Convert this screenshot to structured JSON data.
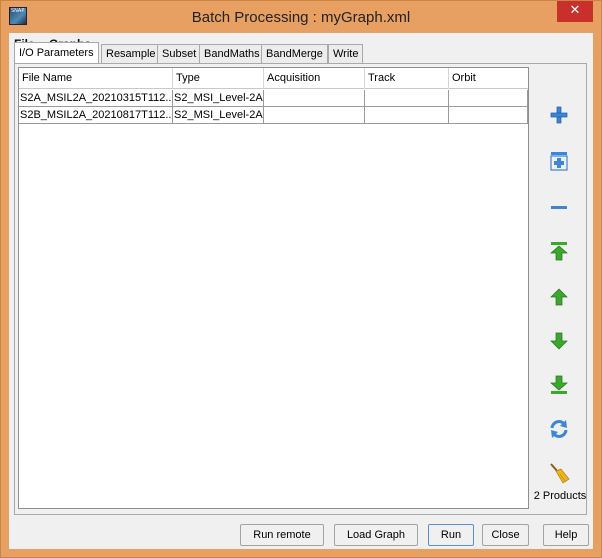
{
  "window": {
    "title": "Batch Processing : myGraph.xml",
    "close_glyph": "✕",
    "app_icon_text": "SNAP"
  },
  "menu": [
    "File",
    "Graphs"
  ],
  "tabs": [
    "I/O Parameters",
    "Resample",
    "Subset",
    "BandMaths",
    "BandMerge",
    "Write"
  ],
  "table": {
    "columns": [
      "File Name",
      "Type",
      "Acquisition",
      "Track",
      "Orbit"
    ],
    "rows": [
      [
        "S2A_MSIL2A_20210315T112...",
        "S2_MSI_Level-2A",
        "",
        "",
        ""
      ],
      [
        "S2B_MSIL2A_20210817T112...",
        "S2_MSI_Level-2A",
        "",
        "",
        ""
      ]
    ]
  },
  "side_buttons": [
    "add-icon",
    "add-opened-icon",
    "remove-icon",
    "move-top-icon",
    "move-up-icon",
    "move-down-icon",
    "move-bottom-icon",
    "refresh-icon",
    "clear-icon"
  ],
  "products_label": "2 Products",
  "buttons": {
    "run_remote": "Run remote",
    "load_graph": "Load Graph",
    "run": "Run",
    "close": "Close",
    "help": "Help"
  },
  "colors": {
    "titlebar": "#e8a062",
    "close": "#c9302c",
    "arrow_green": "#3aa82c",
    "icon_blue": "#3b86d6"
  }
}
